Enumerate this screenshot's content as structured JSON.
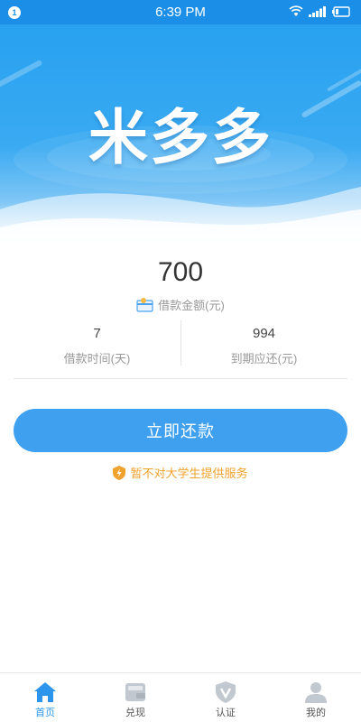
{
  "status_bar": {
    "notification_count": "1",
    "time": "6:39 PM",
    "icons": [
      "wifi-icon",
      "signal-icon",
      "battery-icon"
    ]
  },
  "hero": {
    "brand_logo": "米多多"
  },
  "loan": {
    "amount": "700",
    "amount_label": "借款金额(元)",
    "term_value": "7",
    "term_label": "借款时间(天)",
    "due_value": "994",
    "due_label": "到期应还(元)"
  },
  "actions": {
    "repay_label": "立即还款"
  },
  "notice": {
    "text": "暂不对大学生提供服务"
  },
  "tabs": [
    {
      "label": "首页",
      "icon": "home-icon",
      "active": true
    },
    {
      "label": "兑现",
      "icon": "wallet-icon",
      "active": false
    },
    {
      "label": "认证",
      "icon": "shield-icon",
      "active": false
    },
    {
      "label": "我的",
      "icon": "user-icon",
      "active": false
    }
  ],
  "colors": {
    "primary": "#3fa0f0",
    "status_bar": "#1b8fe8",
    "notice": "#f0a22e",
    "tab_active": "#2d96ec",
    "tab_inactive": "#c2c8cf"
  }
}
